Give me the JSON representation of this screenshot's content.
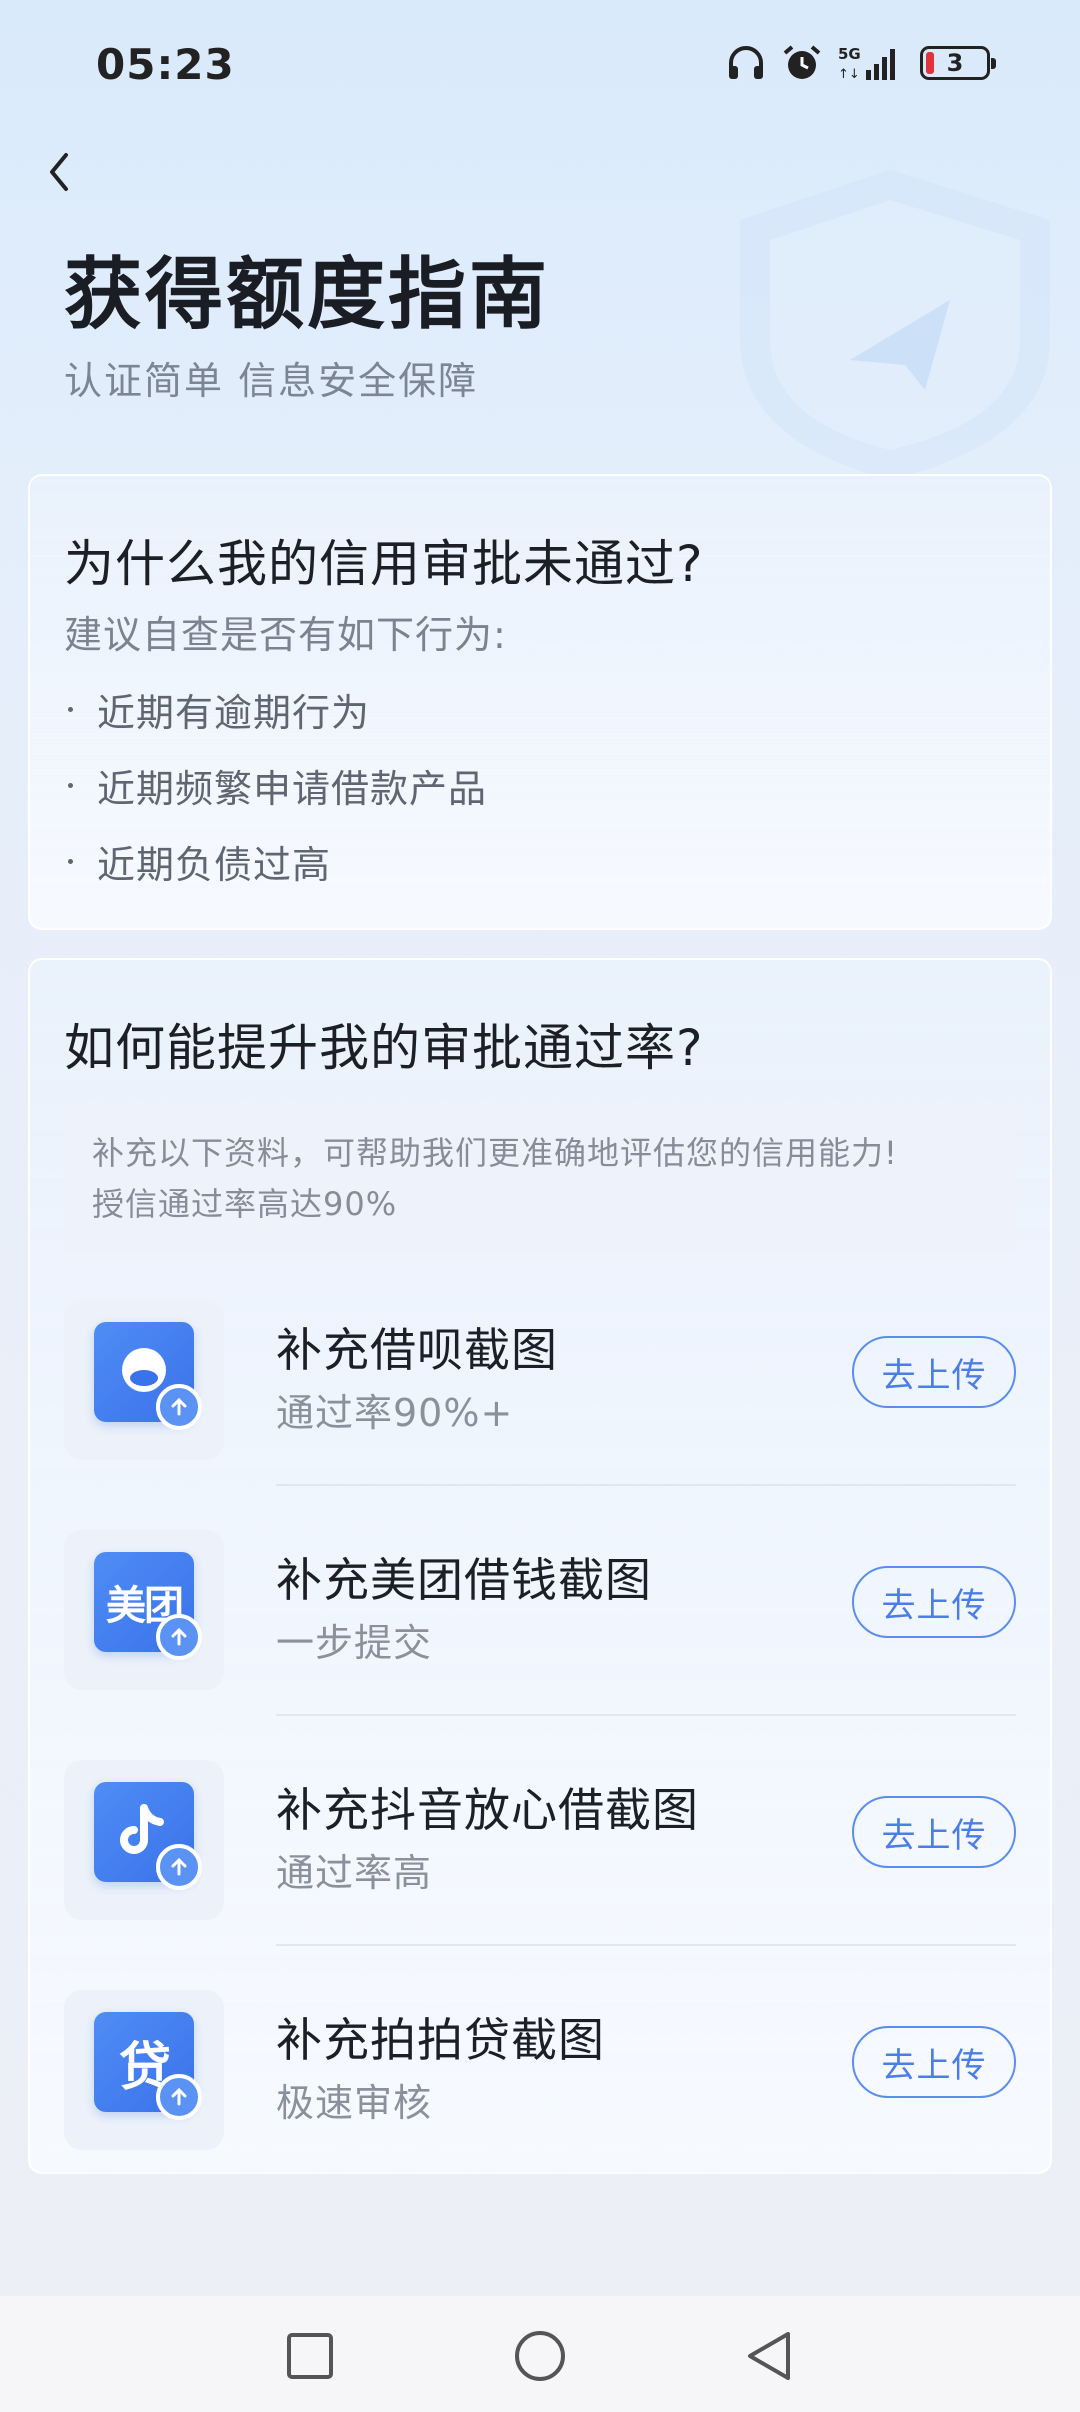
{
  "status_bar": {
    "time": "05:23",
    "network": "5G",
    "battery": "3",
    "icons": [
      "headphones-icon",
      "alarm-icon",
      "signal-5g-icon",
      "battery-icon"
    ]
  },
  "header": {
    "back_icon": "chevron-left-icon",
    "title": "获得额度指南",
    "subtitle": "认证简单 信息安全保障"
  },
  "reasons_card": {
    "title": "为什么我的信用审批未通过?",
    "hint": "建议自查是否有如下行为:",
    "items": [
      "近期有逾期行为",
      "近期频繁申请借款产品",
      "近期负债过高"
    ]
  },
  "improve_card": {
    "title": "如何能提升我的审批通过率?",
    "tip_line1": "补充以下资料，可帮助我们更准确地评估您的信用能力!",
    "tip_line2": "授信通过率高达90%",
    "items": [
      {
        "title": "补充借呗截图",
        "subtitle": "通过率90%+",
        "button": "去上传",
        "icon": "jiebei-icon"
      },
      {
        "title": "补充美团借钱截图",
        "subtitle": "一步提交",
        "button": "去上传",
        "icon": "meituan-icon",
        "icon_text": "美团"
      },
      {
        "title": "补充抖音放心借截图",
        "subtitle": "通过率高",
        "button": "去上传",
        "icon": "douyin-icon"
      },
      {
        "title": "补充拍拍贷截图",
        "subtitle": "极速审核",
        "button": "去上传",
        "icon": "paipaidai-icon",
        "icon_text": "贷"
      }
    ]
  },
  "nav_bar": {
    "buttons": [
      "recent-apps-icon",
      "home-icon",
      "back-icon"
    ]
  },
  "colors": {
    "accent": "#4a7ee6",
    "icon_blue": "#4f8df5",
    "battery_low": "#e2333a"
  }
}
